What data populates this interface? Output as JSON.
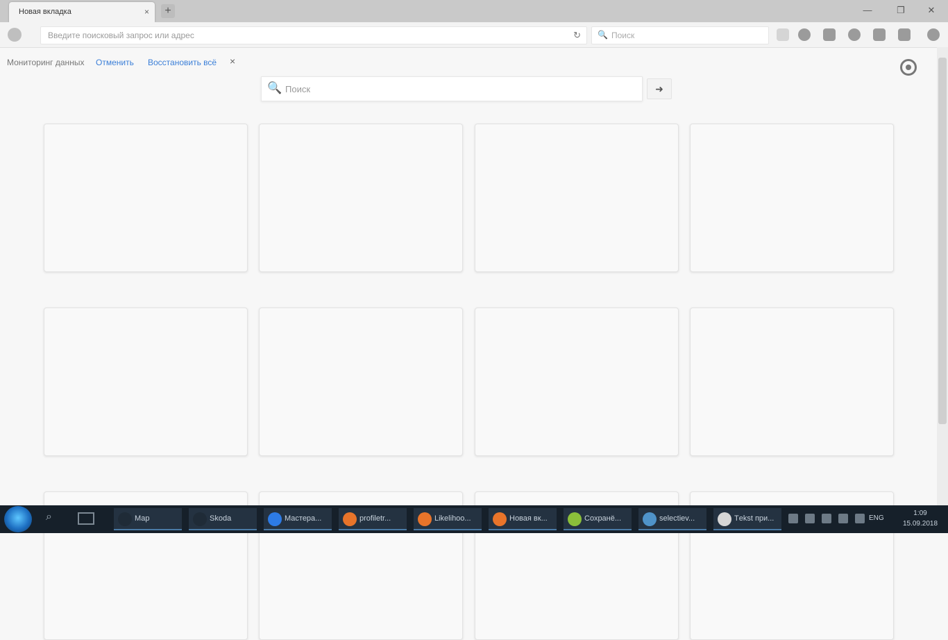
{
  "browser": {
    "tab_title": "Новая вкладка",
    "tab_close": "×",
    "new_tab": "+",
    "window_controls": {
      "minimize": "—",
      "maximize": "❐",
      "close": "✕"
    },
    "url_placeholder": "Введите поисковый запрос или адрес",
    "search_placeholder": "Поиск",
    "reload_glyph": "↻",
    "search_glyph": "🔍"
  },
  "notification": {
    "text": "Мониторинг данных",
    "link_1": "Отменить",
    "link_2": "Восстановить всё",
    "close": "×"
  },
  "page_search": {
    "placeholder": "Поиск",
    "icon": "🔍",
    "go_glyph": "➜"
  },
  "tiles": {
    "count": 12
  },
  "taskbar": {
    "items": [
      {
        "label": "Мар",
        "icon_color": "#1f2b37"
      },
      {
        "label": "Skoda",
        "icon_color": "#1f2b37"
      },
      {
        "label": "Мастера...",
        "icon_color": "#2d7be5"
      },
      {
        "label": "profiletr...",
        "icon_color": "#e8742a"
      },
      {
        "label": "Likelihoo...",
        "icon_color": "#e8742a"
      },
      {
        "label": "Новая вк...",
        "icon_color": "#e8742a"
      },
      {
        "label": "Сохранё...",
        "icon_color": "#8bbf3a"
      },
      {
        "label": "selectiev...",
        "icon_color": "#4f93c9"
      },
      {
        "label": "Tеkst при...",
        "icon_color": "#d6d6d6"
      }
    ],
    "tray_lang": "ENG",
    "clock_time": "1:09",
    "clock_date": "15.09.2018"
  }
}
